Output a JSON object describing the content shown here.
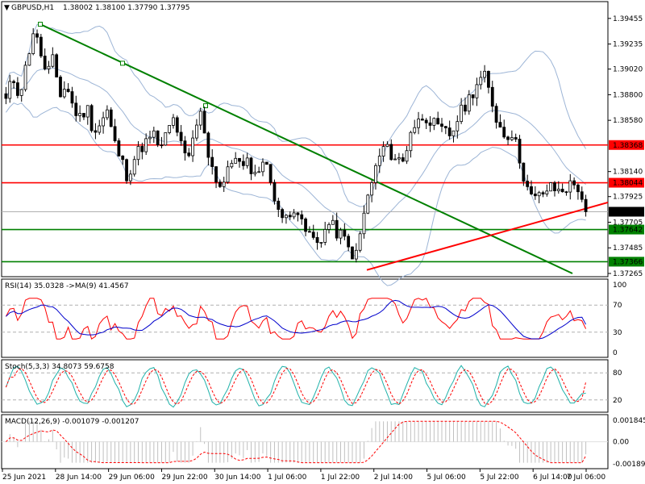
{
  "header": {
    "symbol_tf": "GBPUSD,H1",
    "ohlc": "1.38002 1.38100 1.37790 1.37795"
  },
  "chart_data": [
    {
      "type": "candlestick",
      "title": "GBPUSD,H1",
      "price_range": [
        1.37265,
        1.3953
      ],
      "price_ticks": [
        "1.39455",
        "1.39235",
        "1.39020",
        "1.38800",
        "1.38580",
        "1.38140",
        "1.37925",
        "1.37705",
        "1.37485",
        "1.37265"
      ],
      "current_price": "1.37795",
      "x_labels": [
        "25 Jun 2021",
        "28 Jun 14:00",
        "29 Jun 06:00",
        "29 Jun 22:00",
        "30 Jun 14:00",
        "1 Jul 06:00",
        "1 Jul 22:00",
        "2 Jul 14:00",
        "5 Jul 06:00",
        "5 Jul 22:00",
        "6 Jul 14:00",
        "7 Jul 06:00"
      ],
      "horizontal_levels": [
        {
          "value": "1.38368",
          "color": "#ff0000"
        },
        {
          "value": "1.38044",
          "color": "#ff0000"
        },
        {
          "value": "1.37642",
          "color": "#008000"
        },
        {
          "value": "1.37366",
          "color": "#008000"
        }
      ],
      "trendlines": [
        {
          "color": "#008000",
          "from_price": 1.39405,
          "to_price": 1.37265
        },
        {
          "color": "#ff0000",
          "from_price": 1.37295,
          "to_price": 1.37875
        }
      ],
      "indicators": [
        "Bollinger Bands"
      ],
      "ohlc_path": [
        1.3875,
        1.3895,
        1.388,
        1.3905,
        1.3935,
        1.392,
        1.3895,
        1.391,
        1.388,
        1.3888,
        1.3868,
        1.386,
        1.387,
        1.3848,
        1.3855,
        1.3866,
        1.384,
        1.3825,
        1.381,
        1.3825,
        1.3835,
        1.384,
        1.3845,
        1.3832,
        1.385,
        1.386,
        1.3835,
        1.382,
        1.385,
        1.3865,
        1.383,
        1.381,
        1.38,
        1.3815,
        1.383,
        1.3815,
        1.3822,
        1.381,
        1.3825,
        1.3812,
        1.379,
        1.377,
        1.378,
        1.3785,
        1.3765,
        1.376,
        1.3752,
        1.376,
        1.377,
        1.3762,
        1.3758,
        1.3745,
        1.3742,
        1.3775,
        1.38,
        1.382,
        1.3835,
        1.383,
        1.3825,
        1.3822,
        1.385,
        1.3855,
        1.3863,
        1.3858,
        1.385,
        1.3848,
        1.3845,
        1.386,
        1.387,
        1.388,
        1.3892,
        1.3895,
        1.3875,
        1.3855,
        1.3845,
        1.3848,
        1.383,
        1.3805,
        1.379,
        1.3792,
        1.3798,
        1.38,
        1.3797,
        1.38,
        1.3803,
        1.38,
        1.378
      ]
    },
    {
      "type": "line",
      "title": "RSI(14) 35.0328  ->MA(9) 41.4567",
      "ylim": [
        0,
        100
      ],
      "y_ticks": [
        "100",
        "70",
        "30",
        "0"
      ],
      "series": [
        {
          "name": "RSI(14)",
          "color": "#ff0000",
          "value": 35.0328
        },
        {
          "name": "MA(9)",
          "color": "#0000cc",
          "value": 41.4567
        }
      ]
    },
    {
      "type": "line",
      "title": "Stoch(5,3,3) 34.8073 59.6758",
      "ylim": [
        0,
        100
      ],
      "y_ticks": [
        "80",
        "20"
      ],
      "series": [
        {
          "name": "Main",
          "color": "#20b2aa",
          "value": 34.8073
        },
        {
          "name": "Signal",
          "color": "#ff0000",
          "value": 59.6758
        }
      ]
    },
    {
      "type": "bar",
      "title": "MACD(12,26,9) -0.001079 -0.001207",
      "y_ticks": [
        "0.001845",
        "0.00",
        "-0.001899"
      ],
      "series": [
        {
          "name": "MACD",
          "color": "#c0c0c0",
          "value": -0.001079
        },
        {
          "name": "Signal",
          "color": "#ff0000",
          "value": -0.001207
        }
      ]
    }
  ]
}
